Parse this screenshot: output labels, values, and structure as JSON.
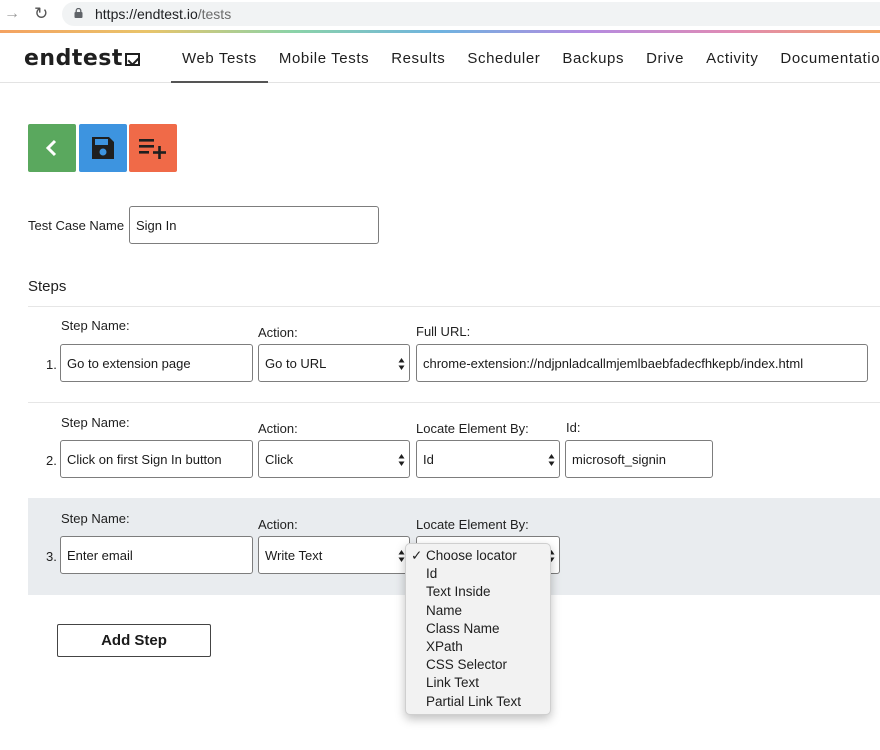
{
  "browser": {
    "url_host": "https://endtest.io",
    "url_path": "/tests"
  },
  "app": {
    "logo": "endtest",
    "nav": [
      "Web Tests",
      "Mobile Tests",
      "Results",
      "Scheduler",
      "Backups",
      "Drive",
      "Activity",
      "Documentation"
    ],
    "active_nav": "Web Tests"
  },
  "toolbar": {
    "back_icon": "chevron-left-icon",
    "save_icon": "floppy-disk-icon",
    "add_icon": "playlist-add-icon"
  },
  "test_case": {
    "label": "Test Case Name",
    "value": "Sign In"
  },
  "steps_heading": "Steps",
  "steps": [
    {
      "number": "1.",
      "step_name_label": "Step Name:",
      "step_name": "Go to extension page",
      "action_label": "Action:",
      "action": "Go to URL",
      "param_label": "Full URL:",
      "param_value": "chrome-extension://ndjpnladcallmjemlbaebfadecfhkepb/index.html"
    },
    {
      "number": "2.",
      "step_name_label": "Step Name:",
      "step_name": "Click on first Sign In button",
      "action_label": "Action:",
      "action": "Click",
      "locate_label": "Locate Element By:",
      "locate_value": "Id",
      "id_label": "Id:",
      "id_value": "microsoft_signin"
    },
    {
      "number": "3.",
      "step_name_label": "Step Name:",
      "step_name": "Enter email",
      "action_label": "Action:",
      "action": "Write Text",
      "locate_label": "Locate Element By:"
    }
  ],
  "add_step_label": "Add Step",
  "locator_dropdown": {
    "checkmark": "✓",
    "options": [
      "Choose locator",
      "Id",
      "Text Inside",
      "Name",
      "Class Name",
      "XPath",
      "CSS Selector",
      "Link Text",
      "Partial Link Text"
    ],
    "selected": "Choose locator"
  },
  "colors": {
    "back_button": "#5aa85e",
    "save_button": "#3d94e0",
    "add_button": "#f06a48",
    "active_step_bg": "#e9ecef"
  }
}
